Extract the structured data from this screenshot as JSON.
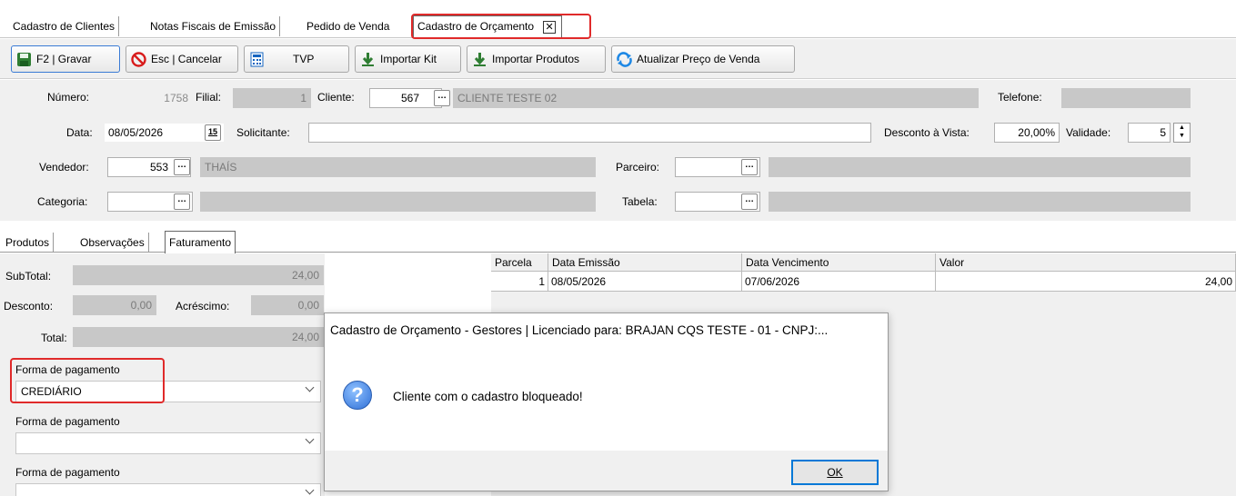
{
  "tabs": [
    "Cadastro de Clientes",
    "Notas Fiscais de Emissão",
    "Pedido de Venda",
    "Cadastro de Orçamento"
  ],
  "toolbar": {
    "gravar": "F2 | Gravar",
    "cancelar": "Esc | Cancelar",
    "tvp": "TVP",
    "importar_kit": "Importar Kit",
    "importar_produtos": "Importar Produtos",
    "atualizar_preco": "Atualizar Preço de Venda"
  },
  "form": {
    "numero_label": "Número:",
    "numero": "1758",
    "filial_label": "Filial:",
    "filial": "1",
    "cliente_label": "Cliente:",
    "cliente_code": "567",
    "cliente_name": "CLIENTE TESTE 02",
    "telefone_label": "Telefone:",
    "telefone": "",
    "data_label": "Data:",
    "data": "08/05/2026",
    "calendar_glyph": "15",
    "solicitante_label": "Solicitante:",
    "solicitante": "",
    "desconto_vista_label": "Desconto à Vista:",
    "desconto_vista": "20,00%",
    "validade_label": "Validade:",
    "validade": "5",
    "vendedor_label": "Vendedor:",
    "vendedor_code": "553",
    "vendedor_name": "THAÍS",
    "parceiro_label": "Parceiro:",
    "parceiro": "",
    "categoria_label": "Categoria:",
    "categoria": "",
    "tabela_label": "Tabela:",
    "tabela": ""
  },
  "subtabs": [
    "Produtos",
    "Observações",
    "Faturamento"
  ],
  "faturamento": {
    "subtotal_label": "SubTotal:",
    "subtotal": "24,00",
    "desconto_label": "Desconto:",
    "desconto": "0,00",
    "acrescimo_label": "Acréscimo:",
    "acrescimo": "0,00",
    "total_label": "Total:",
    "total": "24,00",
    "pagamentos": [
      {
        "label": "Forma de pagamento",
        "value": "CREDIÁRIO"
      },
      {
        "label": "Forma de pagamento",
        "value": ""
      },
      {
        "label": "Forma de pagamento",
        "value": ""
      }
    ]
  },
  "parcelas": {
    "columns": [
      "Parcela",
      "Data Emissão",
      "Data Vencimento",
      "Valor"
    ],
    "rows": [
      [
        "1",
        "08/05/2026",
        "07/06/2026",
        "24,00"
      ]
    ]
  },
  "dialog": {
    "title": "Cadastro de Orçamento - Gestores | Licenciado para: BRAJAN CQS TESTE - 01 - CNPJ:...",
    "message": "Cliente com o cadastro bloqueado!",
    "ok": "OK",
    "icon": "?"
  },
  "colors": {
    "highlight": "#e02a2a",
    "accent": "#0078d7",
    "readonly": "#c8c8c8"
  }
}
